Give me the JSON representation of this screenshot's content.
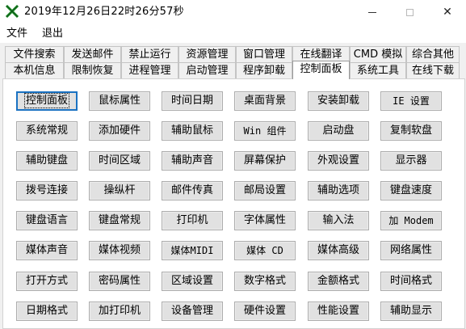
{
  "window": {
    "title": "2019年12月26日22时26分57秒",
    "icon": "app-icon",
    "controls": {
      "minimize": "minimize-icon",
      "maximize": "maximize-icon",
      "close": "close-icon",
      "close_glyph": "✕"
    }
  },
  "menu": {
    "file": "文件",
    "exit": "退出"
  },
  "tabs": {
    "row1": [
      "文件搜索",
      "发送邮件",
      "禁止运行",
      "资源管理",
      "窗口管理",
      "在线翻译",
      "CMD 模拟",
      "综合其他"
    ],
    "row2": [
      "本机信息",
      "限制恢复",
      "进程管理",
      "启动管理",
      "程序卸载",
      "控制面板",
      "系统工具",
      "在线下载"
    ],
    "active": "控制面板"
  },
  "buttons": [
    [
      "控制面板",
      "鼠标属性",
      "时间日期",
      "桌面背景",
      "安装卸载",
      "IE 设置"
    ],
    [
      "系统常规",
      "添加硬件",
      "辅助鼠标",
      "Win 组件",
      "启动盘",
      "复制软盘"
    ],
    [
      "辅助键盘",
      "时间区域",
      "辅助声音",
      "屏幕保护",
      "外观设置",
      "显示器"
    ],
    [
      "拨号连接",
      "操纵杆",
      "邮件传真",
      "邮局设置",
      "辅助选项",
      "键盘速度"
    ],
    [
      "键盘语言",
      "键盘常规",
      "打印机",
      "字体属性",
      "输入法",
      "加 Modem"
    ],
    [
      "媒体声音",
      "媒体视频",
      "媒体MIDI",
      "媒体 CD",
      "媒体高级",
      "网络属性"
    ],
    [
      "打开方式",
      "密码属性",
      "区域设置",
      "数字格式",
      "金额格式",
      "时间格式"
    ],
    [
      "日期格式",
      "加打印机",
      "设备管理",
      "硬件设置",
      "性能设置",
      "辅助显示"
    ]
  ],
  "focused_button": "控制面板"
}
